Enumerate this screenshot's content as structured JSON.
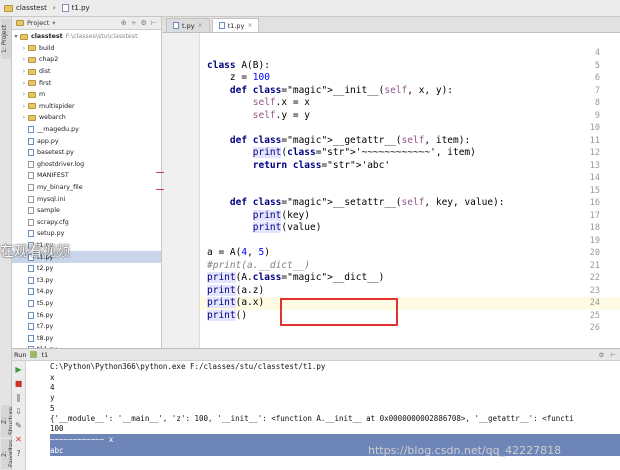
{
  "breadcrumb": {
    "project": "classtest",
    "file": "t1.py"
  },
  "left_tabs": {
    "project": "1: Project",
    "structure": "Z: Structure",
    "favorites": "2: Favorites"
  },
  "project_panel": {
    "title": "Project",
    "root": {
      "name": "classtest",
      "path": "F:\\classes\\stu\\classtest"
    },
    "items": [
      {
        "name": "build",
        "kind": "folder",
        "arrow": "›"
      },
      {
        "name": "chap2",
        "kind": "folder",
        "arrow": "›"
      },
      {
        "name": "dist",
        "kind": "folder",
        "arrow": "›"
      },
      {
        "name": "first",
        "kind": "folder",
        "arrow": "›"
      },
      {
        "name": "m",
        "kind": "folder",
        "arrow": "›"
      },
      {
        "name": "multispider",
        "kind": "folder",
        "arrow": "›"
      },
      {
        "name": "webarch",
        "kind": "folder",
        "arrow": "›"
      },
      {
        "name": "__magedu.py",
        "kind": "py"
      },
      {
        "name": "app.py",
        "kind": "py"
      },
      {
        "name": "basetest.py",
        "kind": "py"
      },
      {
        "name": "ghostdriver.log",
        "kind": "txt"
      },
      {
        "name": "MANIFEST",
        "kind": "txt"
      },
      {
        "name": "my_binary_file",
        "kind": "txt"
      },
      {
        "name": "mysql.ini",
        "kind": "txt"
      },
      {
        "name": "sample",
        "kind": "txt"
      },
      {
        "name": "scrapy.cfg",
        "kind": "txt"
      },
      {
        "name": "setup.py",
        "kind": "py"
      },
      {
        "name": "t1.py",
        "kind": "py"
      },
      {
        "name": "t1.py",
        "kind": "py",
        "selected": true
      },
      {
        "name": "t2.py",
        "kind": "py"
      },
      {
        "name": "t3.py",
        "kind": "py"
      },
      {
        "name": "t4.py",
        "kind": "py"
      },
      {
        "name": "t5.py",
        "kind": "py"
      },
      {
        "name": "t6.py",
        "kind": "py"
      },
      {
        "name": "t7.py",
        "kind": "py"
      },
      {
        "name": "t8.py",
        "kind": "py"
      },
      {
        "name": "t11.py",
        "kind": "py"
      }
    ]
  },
  "watermark": "在观看视频",
  "tabs": [
    {
      "label": "t.py",
      "active": false
    },
    {
      "label": "t1.py",
      "active": true
    }
  ],
  "editor": {
    "line_numbers": [
      "4",
      "5",
      "6",
      "7",
      "8",
      "9",
      "10",
      "11",
      "12",
      "13",
      "14",
      "15",
      "16",
      "17",
      "18",
      "19",
      "20",
      "21",
      "22",
      "23",
      "24",
      "25",
      "26"
    ],
    "lines": [
      "",
      "class A(B):",
      "    z = 100",
      "    def __init__(self, x, y):",
      "        self.x = x",
      "        self.y = y",
      "",
      "    def __getattr__(self, item):",
      "        print('~~~~~~~~~~~~', item)",
      "        return 'abc'",
      "",
      "",
      "    def __setattr__(self, key, value):",
      "        print(key)",
      "        print(value)",
      "",
      "a = A(4, 5)",
      "#print(a.__dict__)",
      "print(A.__dict__)",
      "print(a.z)",
      "print(a.x)",
      "print()",
      ""
    ]
  },
  "run_panel": {
    "label": "Run",
    "config": "t1",
    "command": "C:\\Python\\Python366\\python.exe F:/classes/stu/classtest/t1.py",
    "output": [
      "x",
      "4",
      "y",
      "5",
      "{'__module__': '__main__', 'z': 100, '__init__': <function A.__init__ at 0x0000000002886708>, '__getattr__': <functi",
      "100"
    ],
    "selected_output": [
      "~~~~~~~~~~~~ x",
      "abc"
    ]
  },
  "footer_watermark": "https://blog.csdn.net/qq_42227818"
}
